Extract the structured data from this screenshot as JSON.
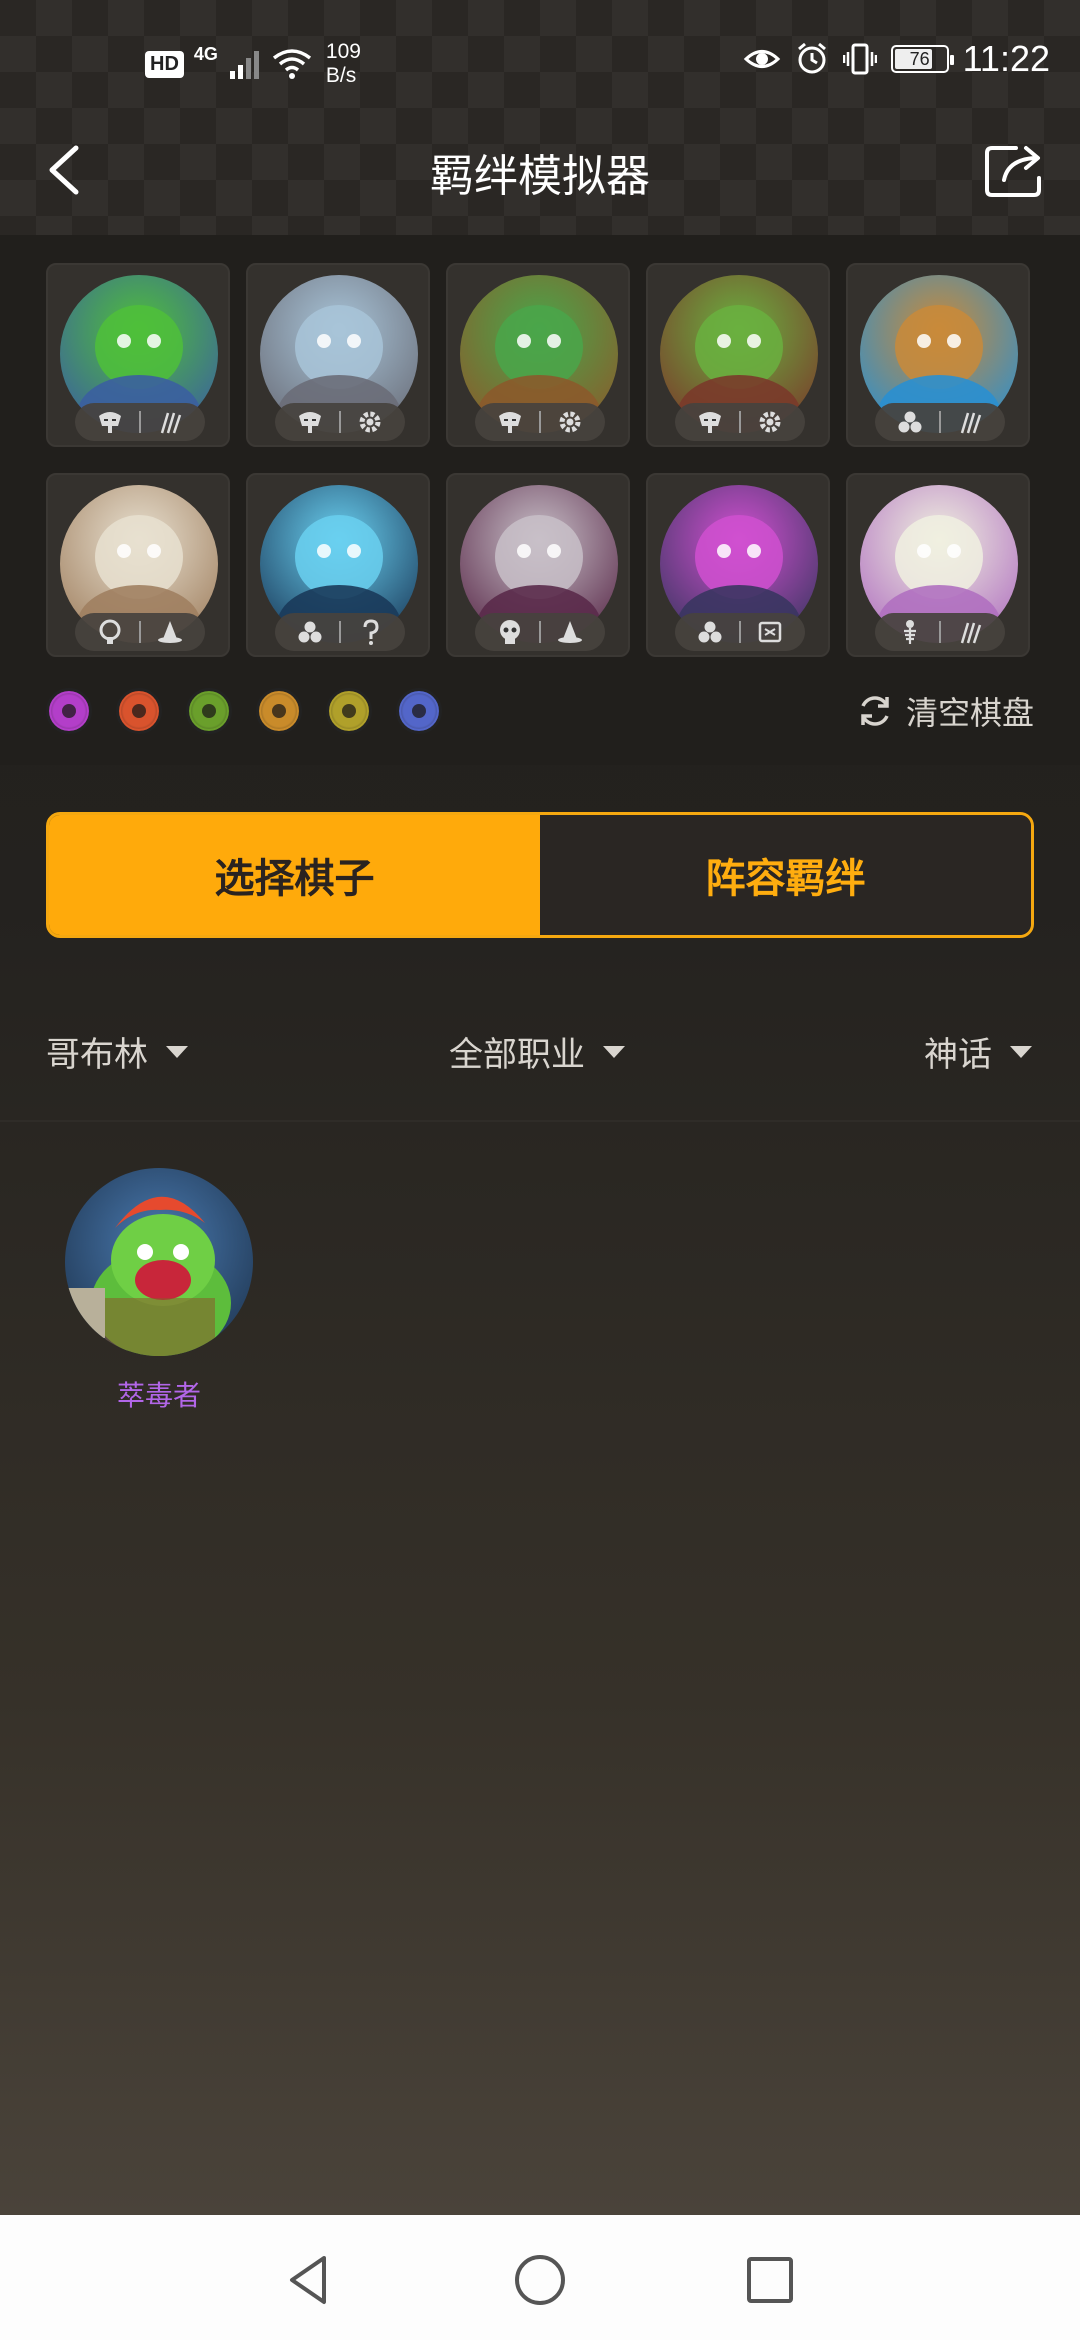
{
  "status_bar": {
    "hd": "HD",
    "network": "4G",
    "speed_value": "109",
    "speed_unit": "B/s",
    "battery": "76",
    "time": "11:22"
  },
  "header": {
    "title": "羁绊模拟器"
  },
  "board": {
    "pieces": [
      {
        "name": "piece-1",
        "colors": [
          "#3b5fa0",
          "#4fbf3a"
        ],
        "race_icon": "demon-mask-icon",
        "class_icon": "claw-icon"
      },
      {
        "name": "piece-2",
        "colors": [
          "#6a6d78",
          "#a8c4d8"
        ],
        "race_icon": "demon-mask-icon",
        "class_icon": "gear-icon"
      },
      {
        "name": "piece-3",
        "colors": [
          "#8b5a2b",
          "#4aa64a"
        ],
        "race_icon": "demon-mask-icon",
        "class_icon": "gear-icon"
      },
      {
        "name": "piece-4",
        "colors": [
          "#7a3a2a",
          "#6ab040"
        ],
        "race_icon": "demon-mask-icon",
        "class_icon": "gear-icon"
      },
      {
        "name": "piece-5",
        "colors": [
          "#2a8fd0",
          "#c98a3a"
        ],
        "race_icon": "triad-icon",
        "class_icon": "claw-icon"
      },
      {
        "name": "piece-6",
        "colors": [
          "#a08060",
          "#e8e0d0"
        ],
        "race_icon": "spirit-icon",
        "class_icon": "wizard-hat-icon"
      },
      {
        "name": "piece-7",
        "colors": [
          "#1a3a5a",
          "#6ad0f0"
        ],
        "race_icon": "triad-icon",
        "class_icon": "hook-icon"
      },
      {
        "name": "piece-8",
        "colors": [
          "#5a2a4a",
          "#c8c0c8"
        ],
        "race_icon": "skull-icon",
        "class_icon": "wizard-hat-icon"
      },
      {
        "name": "piece-9",
        "colors": [
          "#3a3560",
          "#d050d0"
        ],
        "race_icon": "triad-icon",
        "class_icon": "spellbook-icon"
      },
      {
        "name": "piece-10",
        "colors": [
          "#b070c0",
          "#f0f0e0"
        ],
        "race_icon": "fish-bone-icon",
        "class_icon": "claw-icon"
      }
    ]
  },
  "synergies": [
    {
      "name": "demon-synergy-icon",
      "color": "#b33ec9"
    },
    {
      "name": "orc-synergy-icon",
      "color": "#d9532d"
    },
    {
      "name": "elf-synergy-icon",
      "color": "#6a9f2b"
    },
    {
      "name": "mech-synergy-icon",
      "color": "#c98b2a"
    },
    {
      "name": "assassin-synergy-icon",
      "color": "#b0a02a"
    },
    {
      "name": "mage-synergy-icon",
      "color": "#5366c9"
    }
  ],
  "clear_board_label": "清空棋盘",
  "tabs": {
    "select_pieces": "选择棋子",
    "lineup_synergy": "阵容羁绊"
  },
  "filters": {
    "race": "哥布林",
    "class": "全部职业",
    "rarity": "神话"
  },
  "results": [
    {
      "label": "萃毒者",
      "label_color": "#b266e8"
    }
  ],
  "colors": {
    "accent": "#ffaa0b",
    "tab_text_active": "#2a2320"
  }
}
